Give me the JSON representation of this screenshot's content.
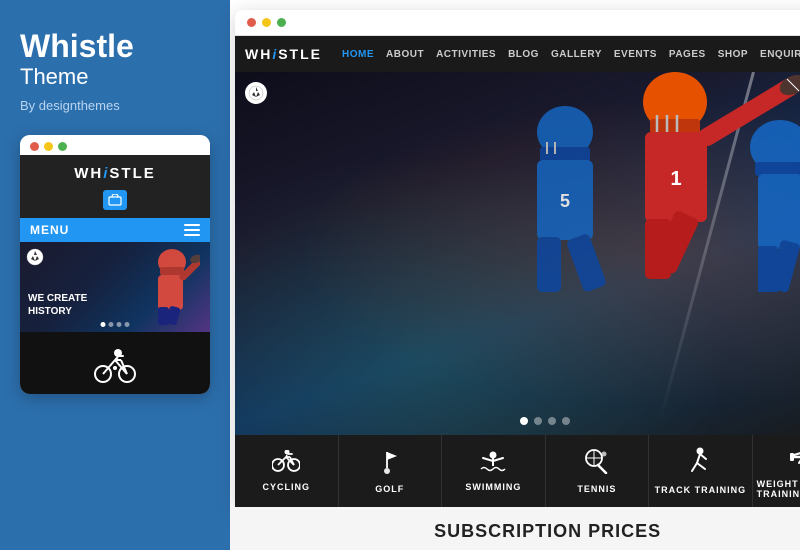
{
  "left": {
    "title": "Whistle",
    "subtitle": "Theme",
    "by": "By designthemes"
  },
  "mobile": {
    "logo": "WHiSTLE",
    "logo_colored_char": "i",
    "menu_label": "MENU",
    "hero_text_line1": "WE CREATE",
    "hero_text_line2": "HISTORY",
    "dots": [
      "active",
      "",
      "",
      ""
    ]
  },
  "browser": {
    "logo": "WHiSTLE",
    "nav_links": [
      "HOME",
      "ABOUT",
      "ACTIVITIES",
      "BLOG",
      "GALLERY",
      "EVENTS",
      "PAGES",
      "SHOP",
      "ENQUIRY"
    ],
    "active_nav": "HOME",
    "hero_dots": [
      "active",
      "",
      "",
      ""
    ],
    "sports": [
      {
        "icon": "🚴",
        "label": "CYCLING"
      },
      {
        "icon": "⛳",
        "label": "GOLF"
      },
      {
        "icon": "🏊",
        "label": "SWIMMING"
      },
      {
        "icon": "🎾",
        "label": "TENNIS"
      },
      {
        "icon": "🏃",
        "label": "TRACK TRAINING"
      },
      {
        "icon": "🏋",
        "label": "WEIGHT TRAINING"
      }
    ]
  },
  "subscription": {
    "title": "SUBSCRIPTION PRICES"
  },
  "colors": {
    "blue": "#2196f3",
    "dark": "#1a1a1a",
    "left_bg": "#2c6fad"
  }
}
